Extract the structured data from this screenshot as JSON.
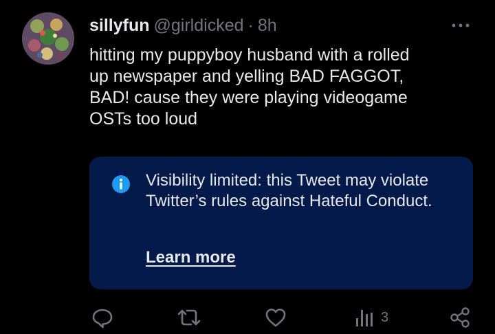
{
  "author": {
    "display_name": "sillyfun",
    "handle": "@girldicked",
    "separator": "·",
    "timestamp": "8h",
    "avatar_icon": "avatar-image"
  },
  "tweet": {
    "text": "hitting my puppyboy husband with a rolled\nup newspaper and yelling BAD FAGGOT,\nBAD! cause they were playing videogame\nOSTs too loud"
  },
  "notice": {
    "icon": "info-icon",
    "text": "Visibility limited: this Tweet may violate Twitter’s rules against Hateful Conduct.",
    "link_label": "Learn more",
    "background": "#041a4a",
    "accent": "#1d9bf0"
  },
  "actions": {
    "reply_icon": "reply-icon",
    "retweet_icon": "retweet-icon",
    "like_icon": "like-icon",
    "views_icon": "views-icon",
    "views_count": "3",
    "share_icon": "share-icon",
    "more_icon": "more-icon"
  },
  "colors": {
    "background": "#000000",
    "primary_text": "#e7e9ea",
    "secondary_text": "#71767b"
  }
}
